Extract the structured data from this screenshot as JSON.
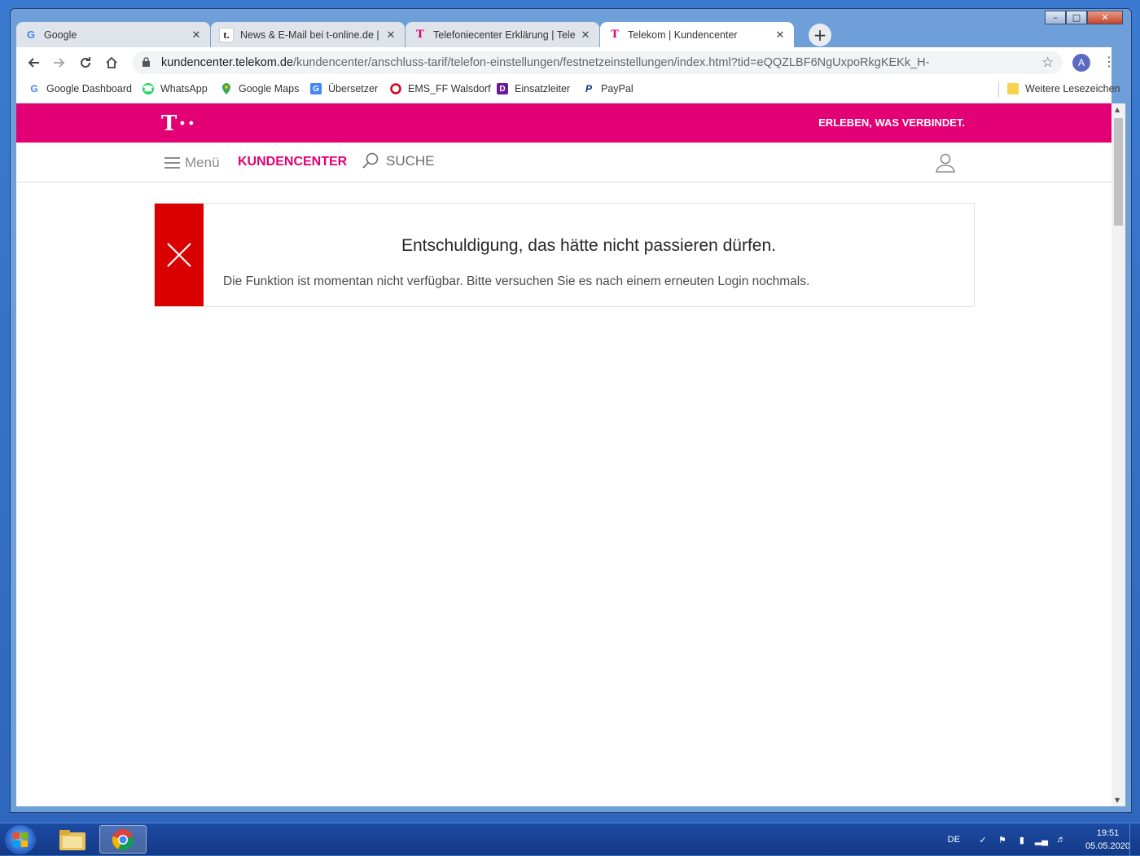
{
  "tabs": [
    {
      "title": "Google",
      "fav": "google-icon"
    },
    {
      "title": "News & E-Mail bei t-online.de | P",
      "fav": "t-online-icon"
    },
    {
      "title": "Telefoniecenter Erklärung | Telek",
      "fav": "telekom-icon"
    },
    {
      "title": "Telekom | Kundencenter",
      "fav": "telekom-icon"
    }
  ],
  "omnibox": {
    "host": "kundencenter.telekom.de",
    "path": "/kundencenter/anschluss-tarif/telefon-einstellungen/festnetzeinstellungen/index.html?tid=eQQZLBF6NgUxpoRkgKEKk_H-"
  },
  "profile_initial": "A",
  "bookmarks": [
    {
      "label": "Google Dashboard"
    },
    {
      "label": "WhatsApp"
    },
    {
      "label": "Google Maps"
    },
    {
      "label": "Übersetzer"
    },
    {
      "label": "EMS_FF Walsdorf"
    },
    {
      "label": "Einsatzleiter"
    },
    {
      "label": "PayPal"
    }
  ],
  "other_bookmarks": "Weitere Lesezeichen",
  "site": {
    "logo": "T··",
    "slogan": "ERLEBEN, WAS VERBINDET.",
    "menu_label": "Menü",
    "kundencenter_label": "KUNDENCENTER",
    "search_label": "SUCHE"
  },
  "error": {
    "title": "Entschuldigung, das hätte nicht passieren dürfen.",
    "message": "Die Funktion ist momentan nicht verfügbar. Bitte versuchen Sie es nach einem erneuten Login nochmals."
  },
  "taskbar": {
    "language": "DE",
    "time": "19:51",
    "date": "05.05.2020"
  },
  "colors": {
    "telekom_magenta": "#e20074",
    "error_red": "#d90000"
  }
}
